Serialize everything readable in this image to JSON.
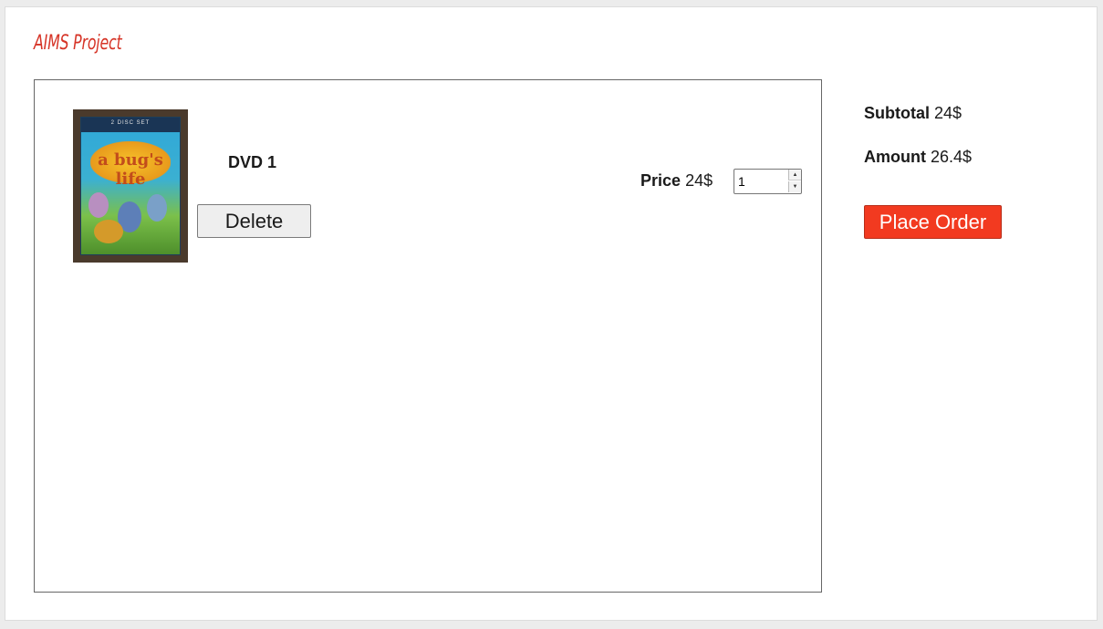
{
  "app": {
    "title": "AIMS Project"
  },
  "cart": {
    "items": [
      {
        "title": "DVD 1",
        "delete_label": "Delete",
        "price_label": "Price",
        "price_value": "24$",
        "quantity": "1",
        "image": {
          "top_banner": "2 DISC SET",
          "logo_text": "a bug's life"
        }
      }
    ]
  },
  "summary": {
    "subtotal_label": "Subtotal",
    "subtotal_value": "24$",
    "amount_label": "Amount",
    "amount_value": "26.4$",
    "place_order_label": "Place Order"
  },
  "colors": {
    "title_accent": "#d63427",
    "place_order_bg": "#f23a20",
    "background": "#ececec",
    "panel_border": "#666666"
  }
}
